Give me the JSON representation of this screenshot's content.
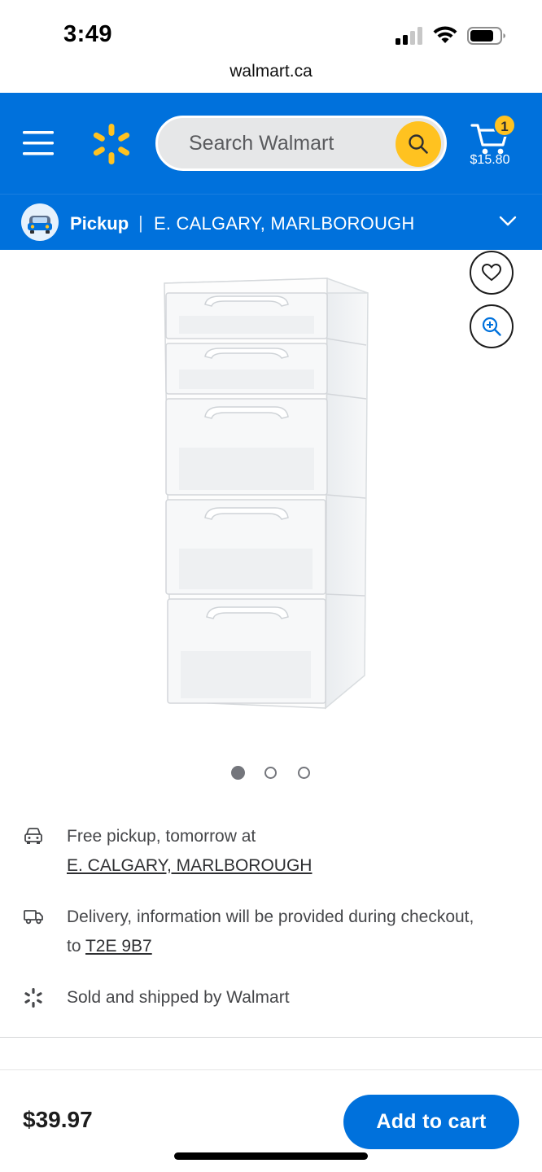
{
  "status_bar": {
    "time": "3:49"
  },
  "browser": {
    "url": "walmart.ca"
  },
  "header": {
    "search_placeholder": "Search Walmart",
    "cart_count": "1",
    "cart_total": "$15.80",
    "brand_color": "#0071dc",
    "accent_color": "#ffc220"
  },
  "pickup_bar": {
    "mode": "Pickup",
    "separator": "|",
    "store": "E. CALGARY, MARLBOROUGH"
  },
  "gallery": {
    "image_count": 3,
    "active_index": 0
  },
  "fulfillment": {
    "pickup": {
      "icon": "car-icon",
      "text": "Free pickup, tomorrow at",
      "store_link": "E. CALGARY, MARLBOROUGH"
    },
    "delivery": {
      "icon": "truck-icon",
      "text": "Delivery, information will be provided during checkout, to",
      "postal_link": "T2E 9B7"
    },
    "seller": {
      "icon": "spark-icon",
      "text": "Sold and shipped by Walmart"
    }
  },
  "bottom_bar": {
    "price": "$39.97",
    "add_to_cart_label": "Add to cart"
  }
}
